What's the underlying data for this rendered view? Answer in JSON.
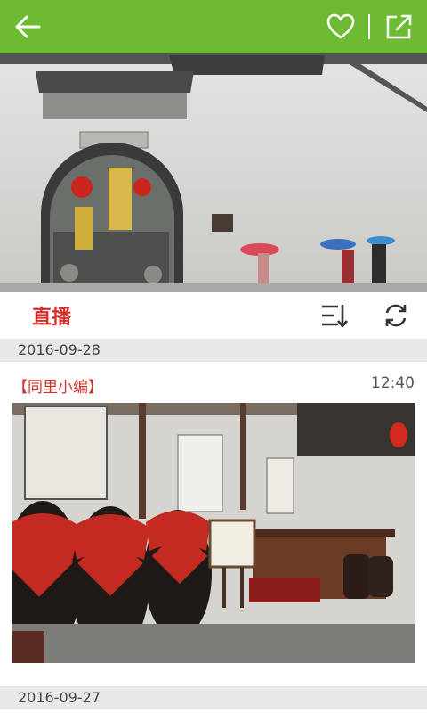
{
  "toolbar": {
    "back_icon": "arrow-left-icon",
    "favorite_icon": "heart-outline-icon",
    "share_icon": "share-external-icon",
    "background_color": "#6cbb32"
  },
  "hero": {
    "image": "whitewashed-wall-with-arched-gate-and-umbrella-walkers"
  },
  "live": {
    "title": "直播",
    "title_color": "#d0312d",
    "sort_icon": "sort-list-icon",
    "refresh_icon": "refresh-icon"
  },
  "feed": {
    "groups": [
      {
        "date": "2016-09-28",
        "posts": [
          {
            "author": "【同里小编】",
            "time": "12:40",
            "image": "wine-museum-interior-with-red-jars"
          }
        ]
      },
      {
        "date": "2016-09-27"
      }
    ]
  }
}
